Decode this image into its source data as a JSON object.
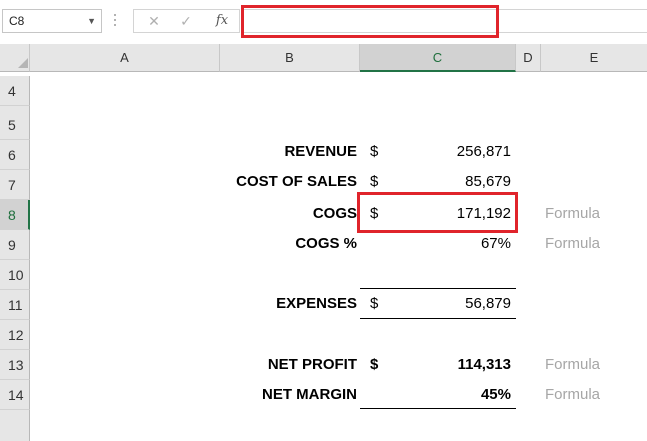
{
  "formula_bar": {
    "name_box": "C8",
    "cancel_icon": "✕",
    "enter_icon": "✓",
    "fx_label": "fx",
    "formula": ""
  },
  "columns": [
    "A",
    "B",
    "C",
    "D",
    "E"
  ],
  "selected_column": "C",
  "rows": [
    "4",
    "5",
    "6",
    "7",
    "8",
    "9",
    "10",
    "11",
    "12",
    "13",
    "14"
  ],
  "selected_row": "8",
  "cells": {
    "revenue": {
      "label": "REVENUE",
      "currency": "$",
      "value": "256,871"
    },
    "cost_of_sales": {
      "label": "COST OF SALES",
      "currency": "$",
      "value": "85,679"
    },
    "cogs": {
      "label": "COGS",
      "currency": "$",
      "value": "171,192",
      "note": "Formula"
    },
    "cogs_pct": {
      "label": "COGS %",
      "value": "67%",
      "note": "Formula"
    },
    "expenses": {
      "label": "EXPENSES",
      "currency": "$",
      "value": "56,879"
    },
    "net_profit": {
      "label": "NET PROFIT",
      "currency": "$",
      "value": "114,313",
      "note": "Formula"
    },
    "net_margin": {
      "label": "NET MARGIN",
      "value": "45%",
      "note": "Formula"
    }
  },
  "colors": {
    "highlight_red": "#e0242b",
    "excel_green": "#217346",
    "note_gray": "#a6a6a6"
  }
}
